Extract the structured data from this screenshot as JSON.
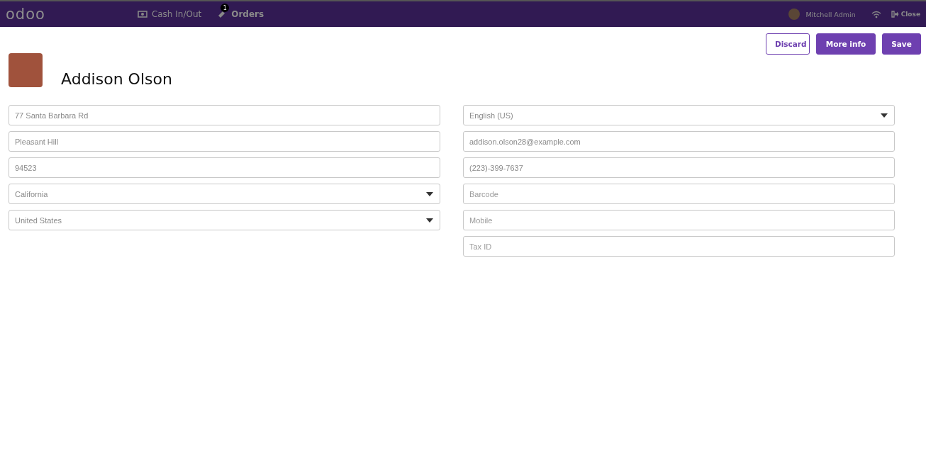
{
  "navbar": {
    "logo": "odoo",
    "items": [
      {
        "kind": "cash",
        "label": "Cash In/Out"
      },
      {
        "kind": "orders",
        "label": "Orders",
        "badge": "1"
      }
    ],
    "user": "Mitchell Admin",
    "close": "Close"
  },
  "actions": [
    {
      "label": "Discard",
      "kind": "secondary"
    },
    {
      "label": "More info",
      "kind": "primary"
    },
    {
      "label": "Save",
      "kind": "primary"
    }
  ],
  "customer": {
    "name": "Addison Olson"
  },
  "left_fields": [
    {
      "kind": "text",
      "value": "77 Santa Barbara Rd"
    },
    {
      "kind": "text",
      "value": "Pleasant Hill"
    },
    {
      "kind": "text",
      "value": "94523"
    },
    {
      "kind": "select",
      "value": "California"
    },
    {
      "kind": "select",
      "value": "United States"
    }
  ],
  "right_fields": [
    {
      "kind": "select",
      "value": "English (US)"
    },
    {
      "kind": "text",
      "value": "addison.olson28@example.com"
    },
    {
      "kind": "text",
      "value": "(223)-399-7637"
    },
    {
      "kind": "text",
      "placeholder": "Barcode"
    },
    {
      "kind": "text",
      "placeholder": "Mobile"
    },
    {
      "kind": "text",
      "placeholder": "Tax ID"
    }
  ]
}
